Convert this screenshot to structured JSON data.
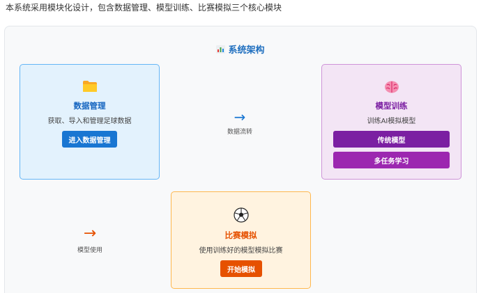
{
  "intro_text": "本系统采用模块化设计，包含数据管理、模型训练、比赛模拟三个核心模块",
  "architecture": {
    "title": "系统架构",
    "title_icon": "bar-chart-icon"
  },
  "modules": {
    "data": {
      "icon": "folder-icon",
      "title": "数据管理",
      "desc": "获取、导入和管理足球数据",
      "button_label": "进入数据管理",
      "accent": "#1976d2"
    },
    "train": {
      "icon": "brain-icon",
      "title": "模型训练",
      "desc": "训练AI模拟模型",
      "buttons": [
        "传统模型",
        "多任务学习"
      ],
      "accent": "#7b1fa2"
    },
    "match": {
      "icon": "soccer-ball-icon",
      "title": "比赛模拟",
      "desc": "使用训练好的模型模拟比赛",
      "button_label": "开始模拟",
      "accent": "#e65100"
    }
  },
  "flows": [
    {
      "glyph": "→",
      "label": "数据流转"
    },
    {
      "glyph": "→",
      "label": "模型使用"
    }
  ]
}
